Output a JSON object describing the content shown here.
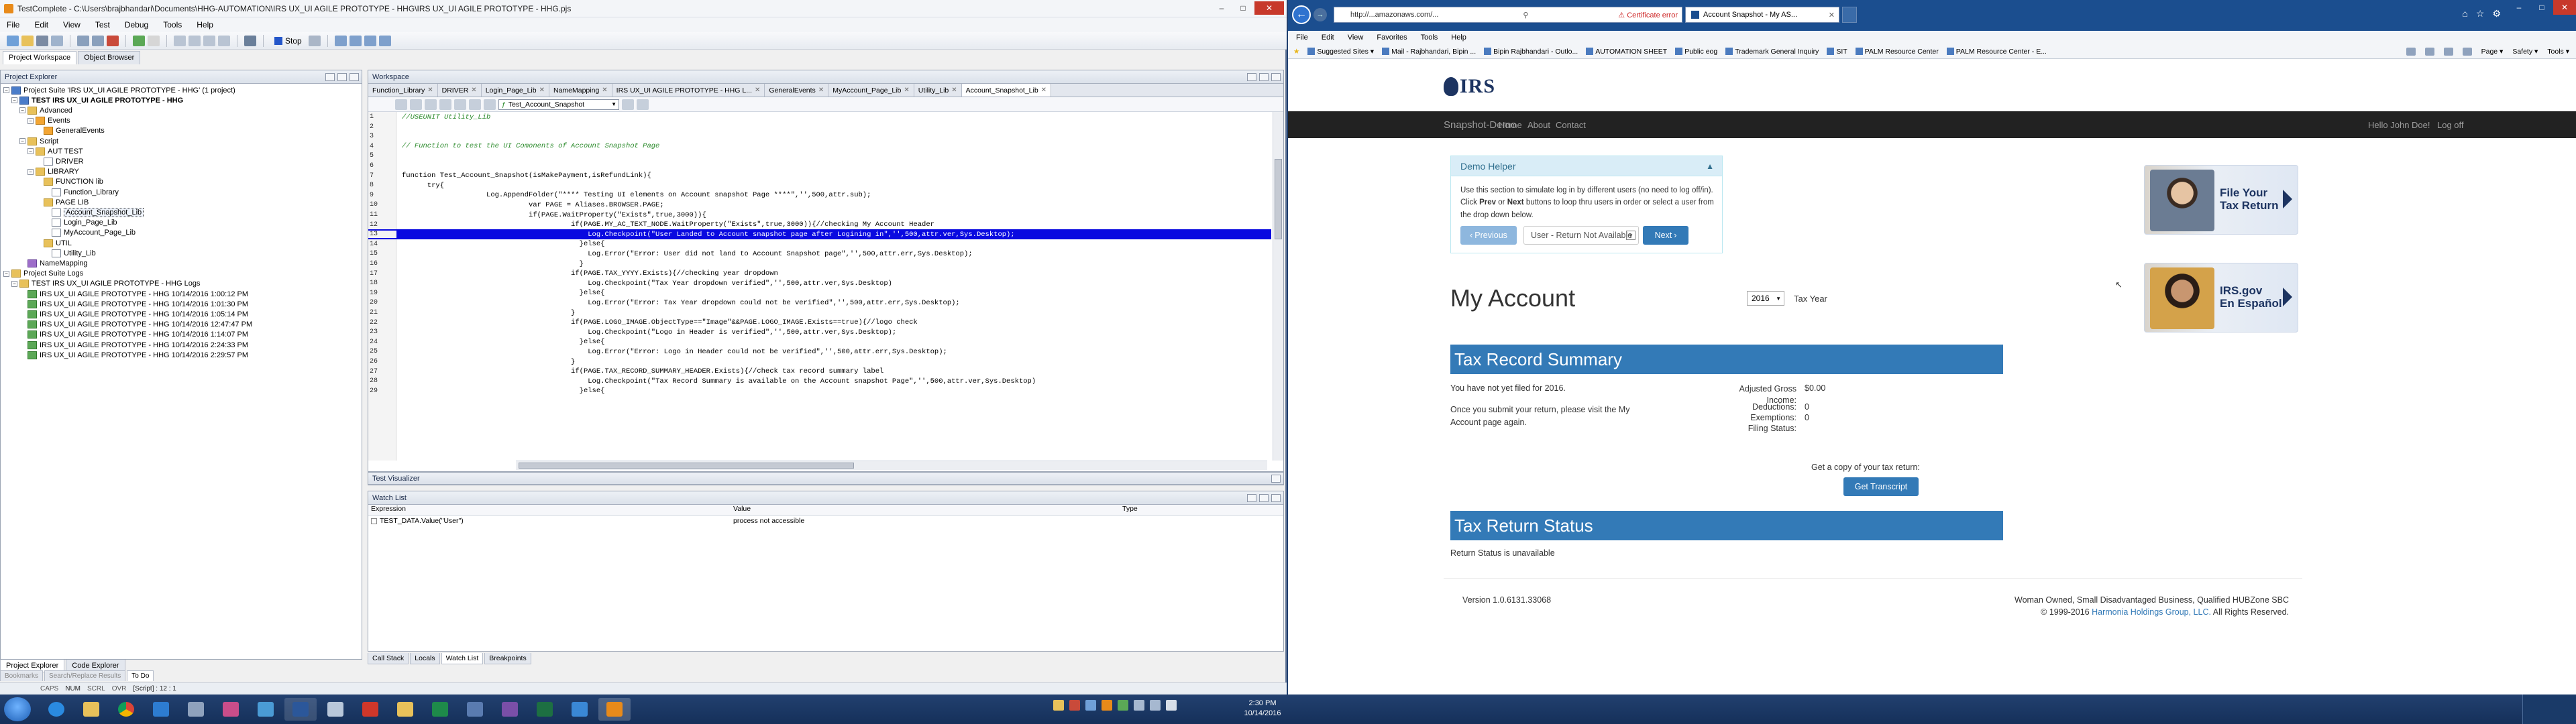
{
  "tc": {
    "title": "TestComplete - C:\\Users\\brajbhandari\\Documents\\HHG-AUTOMATION\\IRS UX_UI AGILE PROTOTYPE - HHG\\IRS UX_UI AGILE PROTOTYPE - HHG.pjs",
    "menu": [
      "File",
      "Edit",
      "View",
      "Test",
      "Debug",
      "Tools",
      "Help"
    ],
    "toolbar_stop": "Stop",
    "top_tabs": [
      "Project Workspace",
      "Object Browser"
    ],
    "project_explorer_title": "Project Explorer",
    "tree": [
      {
        "label": "Project Suite 'IRS UX_UI AGILE PROTOTYPE - HHG' (1 project)",
        "indent": 0,
        "icon": "proj"
      },
      {
        "label": "TEST IRS UX_UI AGILE PROTOTYPE - HHG",
        "indent": 1,
        "icon": "proj",
        "bold": true
      },
      {
        "label": "Advanced",
        "indent": 2,
        "icon": "folder"
      },
      {
        "label": "Events",
        "indent": 3,
        "icon": "event"
      },
      {
        "label": "GeneralEvents",
        "indent": 4,
        "icon": "event"
      },
      {
        "label": "Script",
        "indent": 2,
        "icon": "folder"
      },
      {
        "label": "AUT TEST",
        "indent": 3,
        "icon": "folder"
      },
      {
        "label": "DRIVER",
        "indent": 4,
        "icon": "doc"
      },
      {
        "label": "LIBRARY",
        "indent": 3,
        "icon": "folder"
      },
      {
        "label": "FUNCTION lib",
        "indent": 4,
        "icon": "folder"
      },
      {
        "label": "Function_Library",
        "indent": 5,
        "icon": "doc"
      },
      {
        "label": "PAGE LIB",
        "indent": 4,
        "icon": "folder"
      },
      {
        "label": "Account_Snapshot_Lib",
        "indent": 5,
        "icon": "doc",
        "selected": true
      },
      {
        "label": "Login_Page_Lib",
        "indent": 5,
        "icon": "doc"
      },
      {
        "label": "MyAccount_Page_Lib",
        "indent": 5,
        "icon": "doc"
      },
      {
        "label": "UTIL",
        "indent": 4,
        "icon": "folder"
      },
      {
        "label": "Utility_Lib",
        "indent": 5,
        "icon": "doc"
      },
      {
        "label": "NameMapping",
        "indent": 2,
        "icon": "map"
      },
      {
        "label": "Project Suite Logs",
        "indent": 0,
        "icon": "folder"
      },
      {
        "label": "TEST IRS UX_UI AGILE PROTOTYPE - HHG Logs",
        "indent": 1,
        "icon": "folder"
      },
      {
        "label": "IRS UX_UI AGILE PROTOTYPE - HHG 10/14/2016 1:00:12 PM",
        "indent": 2,
        "icon": "log"
      },
      {
        "label": "IRS UX_UI AGILE PROTOTYPE - HHG 10/14/2016 1:01:30 PM",
        "indent": 2,
        "icon": "log"
      },
      {
        "label": "IRS UX_UI AGILE PROTOTYPE - HHG 10/14/2016 1:05:14 PM",
        "indent": 2,
        "icon": "log"
      },
      {
        "label": "IRS UX_UI AGILE PROTOTYPE - HHG 10/14/2016 12:47:47 PM",
        "indent": 2,
        "icon": "log"
      },
      {
        "label": "IRS UX_UI AGILE PROTOTYPE - HHG 10/14/2016 1:14:07 PM",
        "indent": 2,
        "icon": "log"
      },
      {
        "label": "IRS UX_UI AGILE PROTOTYPE - HHG 10/14/2016 2:24:33 PM",
        "indent": 2,
        "icon": "log"
      },
      {
        "label": "IRS UX_UI AGILE PROTOTYPE - HHG 10/14/2016 2:29:57 PM",
        "indent": 2,
        "icon": "log"
      }
    ],
    "pe_bottom_tabs": [
      "Project Explorer",
      "Code Explorer"
    ],
    "workspace_title": "Workspace",
    "ws_tabs": [
      "Function_Library",
      "DRIVER",
      "Login_Page_Lib",
      "NameMapping",
      "IRS UX_UI AGILE PROTOTYPE - HHG L...",
      "GeneralEvents",
      "MyAccount_Page_Lib",
      "Utility_Lib",
      "Account_Snapshot_Lib"
    ],
    "routine": "Test_Account_Snapshot",
    "code": [
      {
        "n": "1",
        "t": "//USEUNIT Utility_Lib",
        "c": "cm"
      },
      {
        "n": "2",
        "t": ""
      },
      {
        "n": "3",
        "t": ""
      },
      {
        "n": "4",
        "t": "// Function to test the UI Comonents of Account Snapshot Page",
        "c": "cm"
      },
      {
        "n": "5",
        "t": ""
      },
      {
        "n": "6",
        "t": ""
      },
      {
        "n": "7",
        "t": "function Test_Account_Snapshot(isMakePayment,isRefundLink){"
      },
      {
        "n": "8",
        "t": "      try{"
      },
      {
        "n": "9",
        "t": "                    Log.AppendFolder(\"**** Testing UI elements on Account snapshot Page ****\",'',500,attr.sub);"
      },
      {
        "n": "10",
        "t": "                              var PAGE = Aliases.BROWSER.PAGE;"
      },
      {
        "n": "11",
        "t": "                              if(PAGE.WaitProperty(\"Exists\",true,3000)){"
      },
      {
        "n": "12",
        "t": "                                        if(PAGE.MY_AC_TEXT_NODE.WaitProperty(\"Exists\",true,3000)){//checking My Account Header"
      },
      {
        "n": "13",
        "t": "                                            Log.Checkpoint(\"User Landed to Account snapshot page after Logining in\",'',500,attr.ver,Sys.Desktop);",
        "hl": true
      },
      {
        "n": "14",
        "t": "                                          }else{"
      },
      {
        "n": "15",
        "t": "                                            Log.Error(\"Error: User did not land to Account Snapshot page\",'',500,attr.err,Sys.Desktop);"
      },
      {
        "n": "16",
        "t": "                                          }"
      },
      {
        "n": "17",
        "t": "                                        if(PAGE.TAX_YYYY.Exists){//checking year dropdown"
      },
      {
        "n": "18",
        "t": "                                            Log.Checkpoint(\"Tax Year dropdown verified\",'',500,attr.ver,Sys.Desktop)"
      },
      {
        "n": "19",
        "t": "                                          }else{"
      },
      {
        "n": "20",
        "t": "                                            Log.Error(\"Error: Tax Year dropdown could not be verified\",'',500,attr.err,Sys.Desktop);"
      },
      {
        "n": "21",
        "t": "                                        }"
      },
      {
        "n": "22",
        "t": "                                        if(PAGE.LOGO_IMAGE.ObjectType==\"Image\"&&PAGE.LOGO_IMAGE.Exists==true){//logo check"
      },
      {
        "n": "23",
        "t": "                                            Log.Checkpoint(\"Logo in Header is verified\",'',500,attr.ver,Sys.Desktop);"
      },
      {
        "n": "24",
        "t": "                                          }else{"
      },
      {
        "n": "25",
        "t": "                                            Log.Error(\"Error: Logo in Header could not be verified\",'',500,attr.err,Sys.Desktop);"
      },
      {
        "n": "26",
        "t": "                                        }"
      },
      {
        "n": "27",
        "t": "                                        if(PAGE.TAX_RECORD_SUMMARY_HEADER.Exists){//check tax record summary label"
      },
      {
        "n": "28",
        "t": "                                            Log.Checkpoint(\"Tax Record Summary is available on the Account snapshot Page\",'',500,attr.ver,Sys.Desktop)"
      },
      {
        "n": "29",
        "t": "                                          }else{"
      }
    ],
    "test_visualizer": "Test Visualizer",
    "watch_list": "Watch List",
    "watch_cols": [
      "Expression",
      "Value",
      "Type"
    ],
    "watch_row": {
      "expr": "TEST_DATA.Value(\"User\")",
      "value": "process not accessible",
      "type": ""
    },
    "ws_bottom_tabs": [
      "Call Stack",
      "Locals",
      "Watch List",
      "Breakpoints"
    ],
    "lower_tabs": [
      "Bookmarks",
      "Search/Replace Results",
      "To Do"
    ],
    "status": "[Script] : 12 : 1"
  },
  "ie": {
    "url": "http://...amazonaws.com/...",
    "cert": "Certificate error",
    "tab": "Account Snapshot - My AS...",
    "menu": [
      "File",
      "Edit",
      "View",
      "Favorites",
      "Tools",
      "Help"
    ],
    "favorites": [
      "Suggested Sites ▾",
      "Mail - Rajbhandari, Bipin ...",
      "Bipin Rajbhandari - Outlo...",
      "AUTOMATION SHEET",
      "Public eog",
      "Trademark General Inquiry",
      "SIT",
      "PALM Resource Center",
      "PALM Resource Center - E..."
    ],
    "cmds": [
      "Page ▾",
      "Safety ▾",
      "Tools ▾"
    ]
  },
  "irs": {
    "logo": "IRS",
    "brand": "Snapshot-Demo",
    "nav": [
      "Home",
      "About",
      "Contact"
    ],
    "user": "Hello John Doe!",
    "logoff": "Log off",
    "demo_title": "Demo Helper",
    "demo_text": "Use this section to simulate log in by different users (no need to log off/in). Click Prev or Next buttons to loop thru users in order or select a user from the drop down below.",
    "prev": "Previous",
    "user_select": "User - Return Not Available",
    "next": "Next",
    "promo1": [
      "File Your",
      "Tax Return"
    ],
    "promo2": [
      "IRS.gov",
      "En Español"
    ],
    "my_account": "My Account",
    "year": "2016",
    "tax_year": "Tax Year",
    "trs_title": "Tax Record Summary",
    "not_filed": "You have not yet filed for 2016.",
    "once_submit": "Once you submit your return, please visit the My Account page again.",
    "kv": [
      {
        "k": "Adjusted Gross Income:",
        "v": "$0.00"
      },
      {
        "k": "Deductions:",
        "v": "0"
      },
      {
        "k": "Exemptions:",
        "v": "0"
      },
      {
        "k": "Filing Status:",
        "v": ""
      }
    ],
    "copy_q": "Get a copy of your tax return:",
    "transcript": "Get Transcript",
    "trst_title": "Tax Return Status",
    "return_status": "Return Status is unavailable",
    "version": "Version 1.0.6131.33068",
    "footer1": "Woman Owned, Small Disadvantaged Business, Qualified HUBZone SBC",
    "footer2a": "© 1999-2016 ",
    "footer2link": "Harmonia Holdings Group, LLC.",
    "footer2b": " All Rights Reserved."
  },
  "taskbar": {
    "time": "2:30 PM",
    "date": "10/14/2016"
  },
  "colors": {
    "irs_blue": "#337ab7",
    "irs_dark": "#222222",
    "highlight": "#0a0ae0"
  }
}
